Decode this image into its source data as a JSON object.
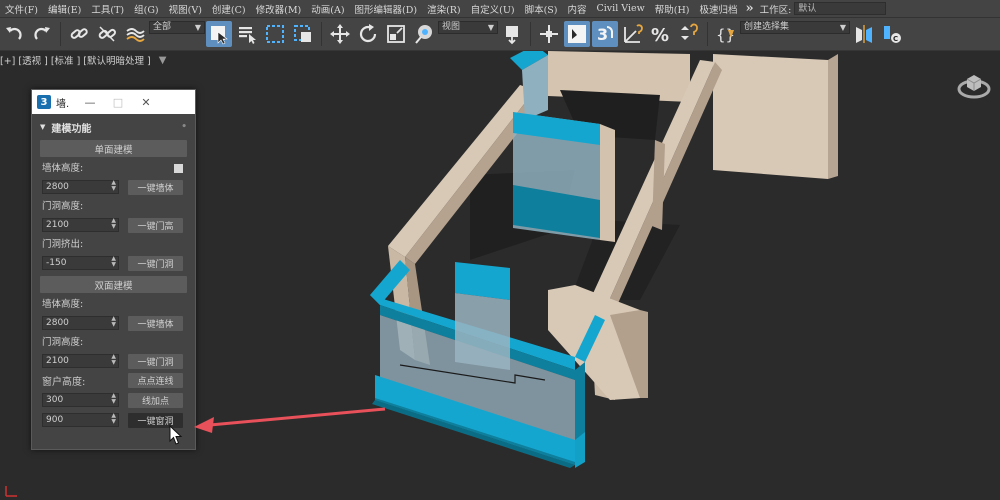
{
  "menubar": {
    "items": [
      "文件(F)",
      "编辑(E)",
      "工具(T)",
      "组(G)",
      "视图(V)",
      "创建(C)",
      "修改器(M)",
      "动画(A)",
      "图形编辑器(D)",
      "渲染(R)",
      "自定义(U)",
      "脚本(S)",
      "内容",
      "Civil View",
      "帮助(H)",
      "极速归档"
    ],
    "overflow": "»",
    "workspace_label": "工作区:",
    "workspace_value": "默认"
  },
  "toolbar": {
    "selection_filter": "全部",
    "ref_coord": "视图",
    "named_selection": "创建选择集"
  },
  "viewport": {
    "label": "[+] [透视 ] [标准 ] [默认明暗处理 ]"
  },
  "dialog": {
    "title": "墙.",
    "rollout_title": "建模功能",
    "single_group": "单面建模",
    "double_group": "双面建模",
    "rows": {
      "s_wall_height_label": "墙体高度:",
      "s_wall_height_value": "2800",
      "s_wall_btn": "一键墙体",
      "s_door_height_label": "门洞高度:",
      "s_door_height_value": "2100",
      "s_door_btn": "一键门高",
      "s_door_extrude_label": "门洞挤出:",
      "s_door_extrude_value": "-150",
      "s_door_hole_btn": "一键门洞",
      "d_wall_height_label": "墙体高度:",
      "d_wall_height_value": "2800",
      "d_wall_btn": "一键墙体",
      "d_door_height_label": "门洞高度:",
      "d_door_height_value": "2100",
      "d_door_btn": "一键门洞",
      "d_window_height_label": "窗户高度:",
      "d_point_btn": "点点连线",
      "d_window_value_1": "300",
      "d_add_point_btn": "线加点",
      "d_window_value_2": "900",
      "d_window_btn": "一键窗洞"
    }
  },
  "colors": {
    "wall": "#d6c7b4",
    "wall_side": "#a99683",
    "frame_blue": "#15a6cf",
    "sill_blue": "#0e7f9c",
    "glass": "#9fb7c4",
    "arrow_red": "#e8505a"
  }
}
